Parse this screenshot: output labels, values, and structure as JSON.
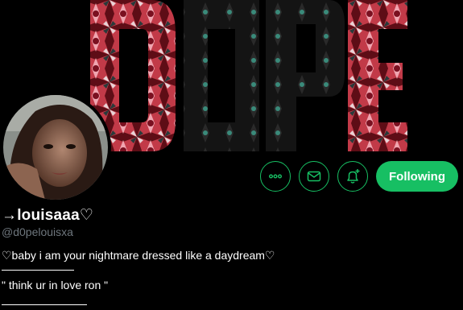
{
  "banner": {
    "text": "D0PE"
  },
  "profile": {
    "display_name": "→louisaaa♡",
    "handle": "@d0pelouisxa",
    "bio_line_1": "♡baby i am your nightmare dressed like a daydream♡",
    "bio_line_2": "\" think ur in love ron \""
  },
  "actions": {
    "more_icon": "more-horizontal-icon",
    "message_icon": "envelope-icon",
    "notify_icon": "bell-plus-icon",
    "follow_label": "Following"
  },
  "colors": {
    "accent": "#17bf63",
    "background": "#000000",
    "secondary_text": "#6e767d"
  }
}
